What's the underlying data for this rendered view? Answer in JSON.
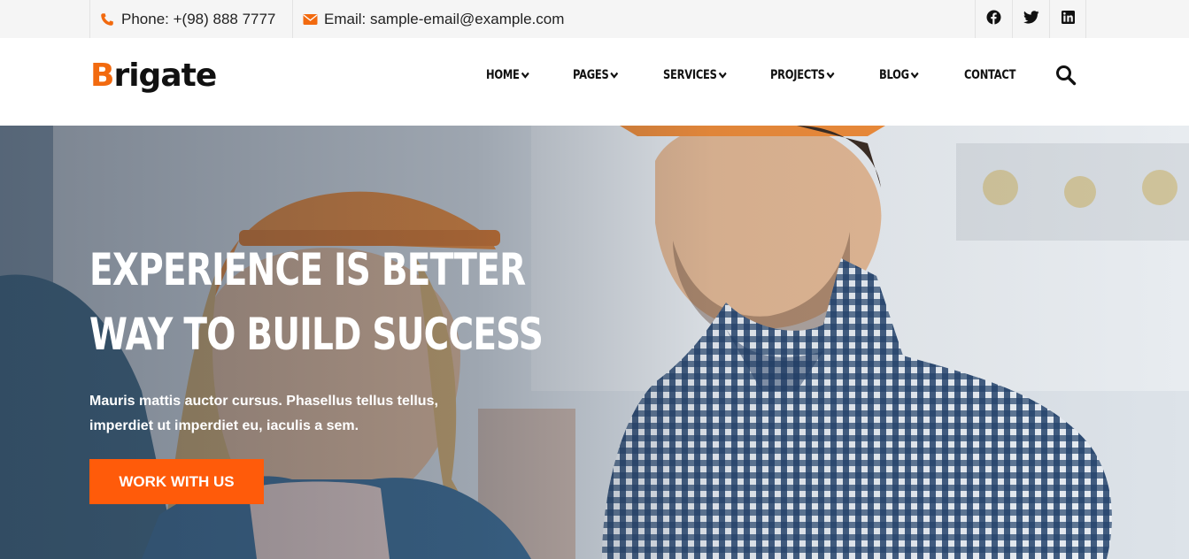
{
  "topbar": {
    "phone": "Phone: +(98) 888 7777",
    "email": "Email: sample-email@example.com",
    "social": [
      "facebook-icon",
      "twitter-icon",
      "linkedin-icon"
    ]
  },
  "header": {
    "logo_first": "B",
    "logo_rest": "rigate",
    "nav": [
      {
        "label": "HOME",
        "has_dropdown": true
      },
      {
        "label": "PAGES",
        "has_dropdown": true
      },
      {
        "label": "SERVICES",
        "has_dropdown": true
      },
      {
        "label": "PROJECTS",
        "has_dropdown": true
      },
      {
        "label": "BLOG",
        "has_dropdown": true
      },
      {
        "label": "CONTACT",
        "has_dropdown": false
      }
    ],
    "search_icon": "search-icon"
  },
  "hero": {
    "title_line1": "EXPERIENCE IS BETTER",
    "title_line2": "WAY TO BUILD SUCCESS",
    "subtitle": "Mauris mattis auctor cursus. Phasellus tellus tellus, imperdiet ut imperdiet eu, iaculis a sem.",
    "cta_label": "WORK WITH US"
  },
  "colors": {
    "accent": "#f26a0f",
    "cta": "#ff5b0a",
    "topbar_bg": "#f5f5f5"
  }
}
